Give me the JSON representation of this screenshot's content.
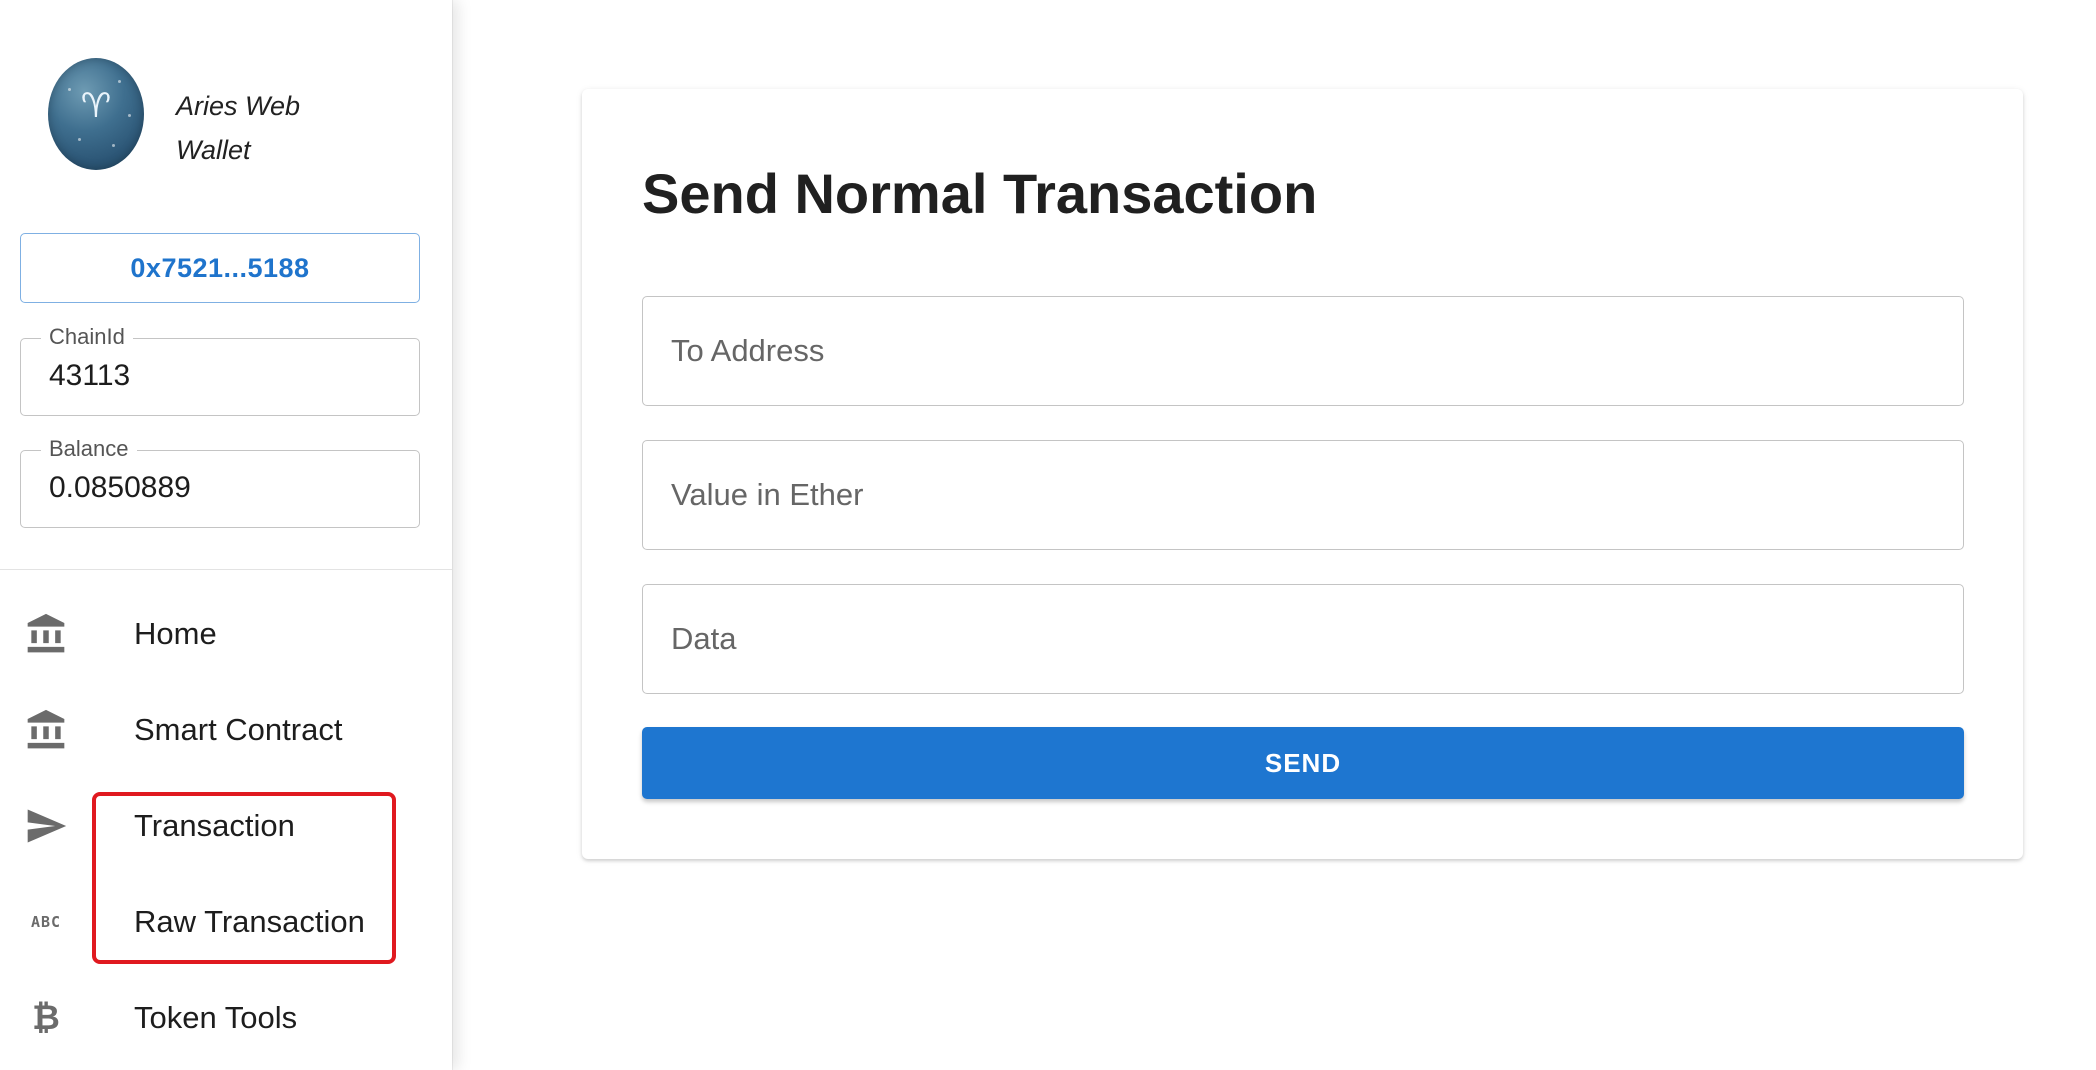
{
  "sidebar": {
    "brand": {
      "name": "Aries Web Wallet",
      "logo_icon": "aries-zodiac-icon",
      "logo_glyph": "♈"
    },
    "address_button": "0x7521...5188",
    "chain_id": {
      "label": "ChainId",
      "value": "43113"
    },
    "balance": {
      "label": "Balance",
      "value": "0.0850889"
    },
    "nav": [
      {
        "label": "Home",
        "icon": "bank-icon"
      },
      {
        "label": "Smart Contract",
        "icon": "bank-icon"
      },
      {
        "label": "Transaction",
        "icon": "send-icon"
      },
      {
        "label": "Raw Transaction",
        "icon": "abc-icon",
        "icon_text": "ABC"
      },
      {
        "label": "Token Tools",
        "icon": "bitcoin-icon",
        "icon_text": "₿"
      }
    ]
  },
  "main": {
    "title": "Send Normal Transaction",
    "fields": {
      "to_address": {
        "placeholder": "To Address",
        "value": ""
      },
      "value_ether": {
        "placeholder": "Value in Ether",
        "value": ""
      },
      "data": {
        "placeholder": "Data",
        "value": ""
      }
    },
    "send_label": "SEND"
  },
  "colors": {
    "accent": "#1e76d0",
    "address_text": "#1f74cc",
    "highlight": "#e0191f",
    "icon_gray": "#6b6b6b"
  }
}
